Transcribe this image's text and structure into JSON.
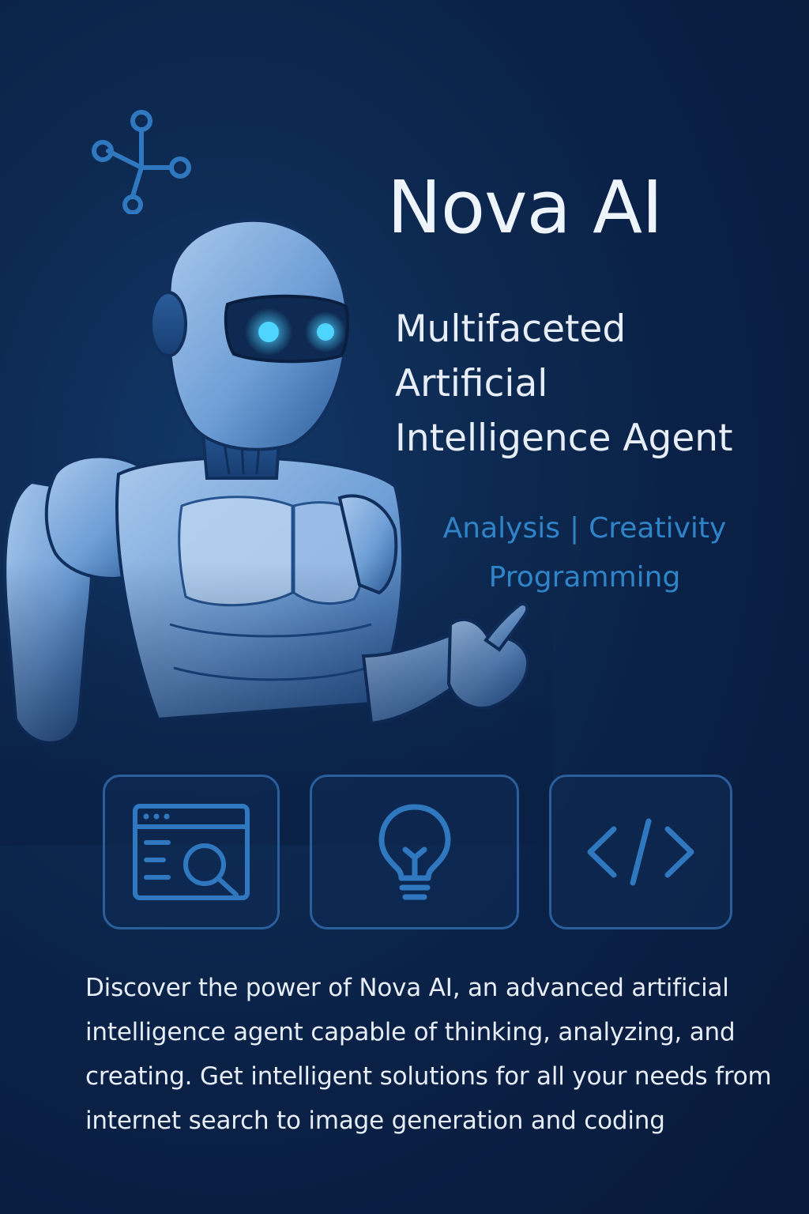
{
  "hero": {
    "title": "Nova AI",
    "subtitle_lines": [
      "Multifaceted",
      "Artificial",
      "Intelligence Agent"
    ],
    "tags": {
      "line1_left": "Analysis",
      "separator": "|",
      "line1_right": "Creativity",
      "line2": "Programming"
    }
  },
  "feature_cards": [
    {
      "icon": "web-search-icon"
    },
    {
      "icon": "lightbulb-icon"
    },
    {
      "icon": "code-icon"
    }
  ],
  "description": "Discover the power of Nova AI, an advanced artificial intelligence agent capable of thinking, analyzing, and creating. Get intelligent solutions for all your needs from internet search to image generation and coding",
  "colors": {
    "background": "#0a2045",
    "accent": "#2f84c8",
    "card_border": "#2a5f9c",
    "eye_glow": "#4fd3ff",
    "text": "#eef4fb"
  }
}
